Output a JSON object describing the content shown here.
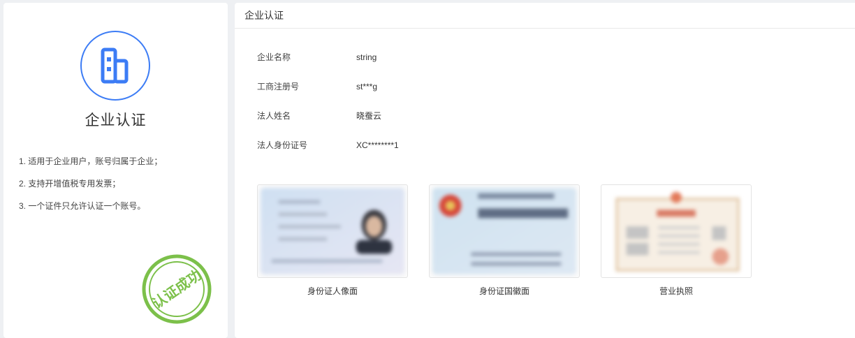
{
  "sidebar": {
    "title": "企业认证",
    "notes": [
      "1. 适用于企业用户，账号归属于企业；",
      "2. 支持开增值税专用发票；",
      "3. 一个证件只允许认证一个账号。"
    ],
    "stamp_text": "认证成功",
    "icon": "building-icon"
  },
  "main": {
    "header_title": "企业认证",
    "fields": [
      {
        "label": "企业名称",
        "value": "string"
      },
      {
        "label": "工商注册号",
        "value": "st***g"
      },
      {
        "label": "法人姓名",
        "value": "晓蚕云"
      },
      {
        "label": "法人身份证号",
        "value": "XC********1"
      }
    ],
    "documents": [
      {
        "caption": "身份证人像面"
      },
      {
        "caption": "身份证国徽面"
      },
      {
        "caption": "营业执照"
      }
    ]
  },
  "colors": {
    "accent": "#3c7cf5",
    "stamp": "#7cc04a"
  }
}
